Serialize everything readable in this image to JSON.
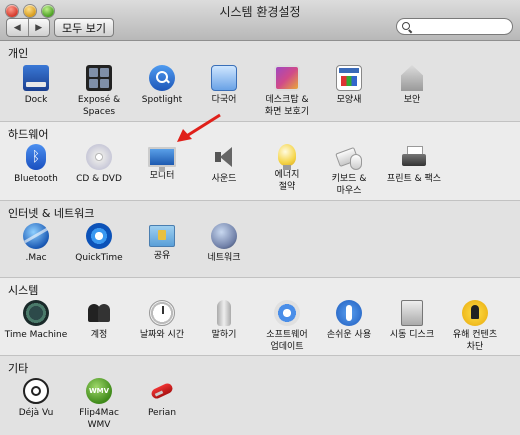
{
  "window": {
    "title": "시스템 환경설정",
    "show_all_label": "모두 보기",
    "back_glyph": "◀",
    "forward_glyph": "▶",
    "search": {
      "value": "",
      "placeholder": ""
    }
  },
  "sections": [
    {
      "title": "개인",
      "items": [
        {
          "label": "Dock",
          "icon": "dock-icon"
        },
        {
          "label": "Exposé &\nSpaces",
          "icon": "expose-spaces-icon"
        },
        {
          "label": "Spotlight",
          "icon": "spotlight-icon"
        },
        {
          "label": "다국어",
          "icon": "international-icon"
        },
        {
          "label": "데스크탑 &\n화면 보호기",
          "icon": "desktop-screensaver-icon"
        },
        {
          "label": "모양새",
          "icon": "appearance-icon"
        },
        {
          "label": "보안",
          "icon": "security-icon"
        }
      ]
    },
    {
      "title": "하드웨어",
      "items": [
        {
          "label": "Bluetooth",
          "icon": "bluetooth-icon"
        },
        {
          "label": "CD & DVD",
          "icon": "cd-dvd-icon"
        },
        {
          "label": "모니터",
          "icon": "displays-icon"
        },
        {
          "label": "사운드",
          "icon": "sound-icon"
        },
        {
          "label": "에너지\n절약",
          "icon": "energy-saver-icon"
        },
        {
          "label": "키보드 &\n마우스",
          "icon": "keyboard-mouse-icon"
        },
        {
          "label": "프린트 & 팩스",
          "icon": "print-fax-icon"
        }
      ]
    },
    {
      "title": "인터넷 & 네트워크",
      "items": [
        {
          "label": ".Mac",
          "icon": "dotmac-icon"
        },
        {
          "label": "QuickTime",
          "icon": "quicktime-icon"
        },
        {
          "label": "공유",
          "icon": "sharing-icon"
        },
        {
          "label": "네트워크",
          "icon": "network-icon"
        }
      ]
    },
    {
      "title": "시스템",
      "items": [
        {
          "label": "Time Machine",
          "icon": "time-machine-icon"
        },
        {
          "label": "계정",
          "icon": "accounts-icon"
        },
        {
          "label": "날짜와 시간",
          "icon": "date-time-icon"
        },
        {
          "label": "말하기",
          "icon": "speech-icon"
        },
        {
          "label": "소프트웨어\n업데이트",
          "icon": "software-update-icon"
        },
        {
          "label": "손쉬운 사용",
          "icon": "universal-access-icon"
        },
        {
          "label": "시동 디스크",
          "icon": "startup-disk-icon"
        },
        {
          "label": "유해 컨텐츠\n차단",
          "icon": "parental-controls-icon"
        }
      ]
    },
    {
      "title": "기타",
      "items": [
        {
          "label": "Déjà Vu",
          "icon": "deja-vu-icon"
        },
        {
          "label": "Flip4Mac\nWMV",
          "icon": "flip4mac-wmv-icon"
        },
        {
          "label": "Perian",
          "icon": "perian-icon"
        }
      ]
    }
  ],
  "icon_text": {
    "bluetooth": "ᛒ",
    "wmv": "WMV"
  },
  "colors": {
    "arrow": "#e0201a"
  }
}
